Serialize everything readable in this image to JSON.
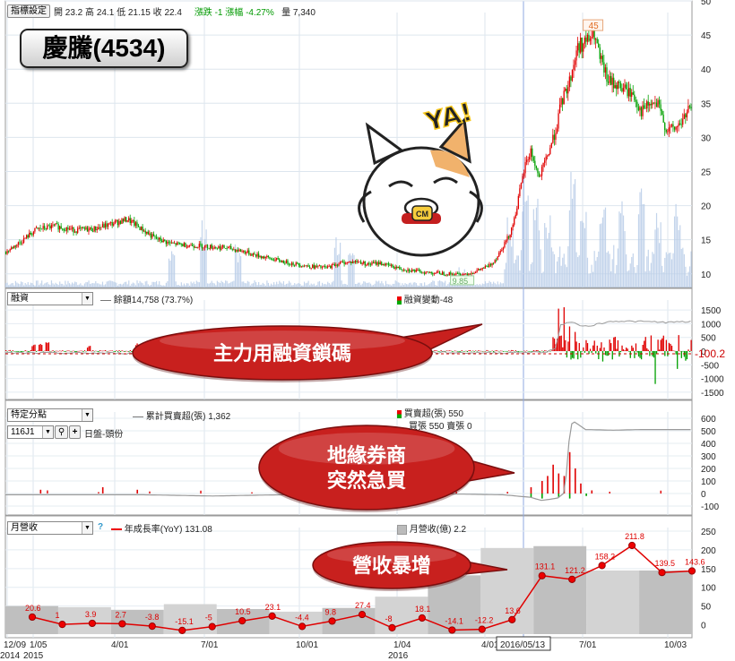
{
  "stock": {
    "name_code": "慶騰(4534)"
  },
  "price_panel": {
    "settings_button": "指標設定",
    "open_label": "開",
    "open": "23.2",
    "high_label": "高",
    "high": "24.1",
    "low_label": "低",
    "low": "21.15",
    "close_label": "收",
    "close": "22.4",
    "change_label": "漲跌",
    "change": "-1",
    "pct_label": "漲幅",
    "pct": "-4.27%",
    "vol_label": "量",
    "vol": "7,340",
    "peak_label": "45",
    "low_tag": "9.85",
    "sticker_text": "YA!",
    "sticker_badge": "CM"
  },
  "margin_panel": {
    "selector": "融資",
    "balance_text": "餘額14,758 (73.7%)",
    "change_text": "融資變動-48",
    "current_tag": "-100.2",
    "callout": "主力用融資鎖碼"
  },
  "broker_panel": {
    "selector": "特定分點",
    "broker_code": "116J1",
    "period_button": "日盤-頭份",
    "cum_text": "累計買賣超(張) 1,362",
    "net_text": "買賣超(張) 550",
    "buy_sell_text": "買張 550 賣張 0",
    "callout_line1": "地緣券商",
    "callout_line2": "突然急買"
  },
  "revenue_panel": {
    "selector": "月營收",
    "help": "?",
    "yoy_text": "年成長率(YoY) 131.08",
    "rev_text": "月營收(億) 2.2",
    "callout": "營收暴增"
  },
  "xaxis": {
    "labels": [
      "12/09",
      "1/05",
      "4/01",
      "7/01",
      "10/01",
      "1/04",
      "4/01",
      "7/01",
      "10/03"
    ],
    "years": [
      "2014",
      "2015",
      "2016"
    ],
    "cursor_date": "2016/05/13"
  },
  "colors": {
    "up": "#e00000",
    "down": "#00a000",
    "yoy_line": "#e00000",
    "callout": "#c8201e"
  },
  "chart_data": [
    {
      "type": "candlestick",
      "title": "慶騰(4534) daily price",
      "ylim": [
        8,
        50
      ],
      "yticks": [
        10,
        15,
        20,
        25,
        30,
        35,
        40,
        45,
        50
      ],
      "close_path": [
        [
          0,
          13.2
        ],
        [
          10,
          14.6
        ],
        [
          22,
          16.5
        ],
        [
          36,
          17
        ],
        [
          50,
          16.4
        ],
        [
          64,
          16.6
        ],
        [
          76,
          17.3
        ],
        [
          88,
          18
        ],
        [
          98,
          16.6
        ],
        [
          108,
          15.2
        ],
        [
          120,
          14.4
        ],
        [
          140,
          14.1
        ],
        [
          160,
          13.8
        ],
        [
          172,
          13.3
        ],
        [
          180,
          12.8
        ],
        [
          192,
          12.2
        ],
        [
          205,
          11.6
        ],
        [
          220,
          11.1
        ],
        [
          232,
          10.9
        ],
        [
          242,
          11.6
        ],
        [
          255,
          11.8
        ],
        [
          262,
          11.4
        ],
        [
          270,
          11.6
        ],
        [
          285,
          10.8
        ],
        [
          300,
          10.3
        ],
        [
          305,
          10.2
        ],
        [
          315,
          10.1
        ],
        [
          325,
          9.95
        ],
        [
          330,
          9.9
        ],
        [
          338,
          10.2
        ],
        [
          343,
          10.6
        ],
        [
          350,
          11.2
        ],
        [
          355,
          12.3
        ],
        [
          360,
          14.2
        ],
        [
          364,
          15.5
        ],
        [
          368,
          18
        ],
        [
          372,
          22
        ],
        [
          376,
          26
        ],
        [
          380,
          28
        ],
        [
          386,
          24
        ],
        [
          392,
          27.3
        ],
        [
          398,
          31
        ],
        [
          402,
          35
        ],
        [
          408,
          38.2
        ],
        [
          414,
          43.3
        ],
        [
          420,
          44
        ],
        [
          426,
          45
        ],
        [
          430,
          41.5
        ],
        [
          436,
          38.2
        ],
        [
          442,
          37.7
        ],
        [
          448,
          37
        ],
        [
          454,
          36.2
        ],
        [
          460,
          33.8
        ],
        [
          466,
          34.8
        ],
        [
          472,
          34.7
        ],
        [
          478,
          31.2
        ],
        [
          484,
          31.2
        ],
        [
          489,
          32.2
        ],
        [
          494,
          34
        ]
      ],
      "volume_spikes": [
        [
          120,
          6
        ],
        [
          143,
          9
        ],
        [
          168,
          5.5
        ],
        [
          240,
          7
        ],
        [
          250,
          5
        ],
        [
          330,
          3
        ],
        [
          365,
          6
        ],
        [
          376,
          11.5
        ],
        [
          384,
          10
        ],
        [
          392,
          7
        ],
        [
          410,
          11
        ],
        [
          418,
          9.5
        ],
        [
          432,
          8
        ],
        [
          446,
          9
        ],
        [
          460,
          10
        ],
        [
          472,
          6
        ],
        [
          486,
          7
        ]
      ],
      "peak": 45,
      "low": 9.85
    },
    {
      "type": "bar",
      "title": "融資變動",
      "ylim": [
        -1700,
        1700
      ],
      "yticks": [
        1500,
        1000,
        500,
        0,
        -500,
        -1000,
        -1500
      ],
      "spikes": [
        [
          20,
          220
        ],
        [
          25,
          260
        ],
        [
          30,
          300
        ],
        [
          60,
          180
        ],
        [
          95,
          280
        ],
        [
          120,
          320
        ],
        [
          400,
          1550
        ],
        [
          404,
          1600
        ],
        [
          408,
          900
        ],
        [
          412,
          700
        ],
        [
          420,
          400
        ],
        [
          426,
          380
        ],
        [
          440,
          500
        ],
        [
          456,
          280
        ],
        [
          480,
          300
        ],
        [
          410,
          -250
        ],
        [
          414,
          -300
        ],
        [
          432,
          -380
        ],
        [
          444,
          -200
        ],
        [
          460,
          -300
        ],
        [
          470,
          -1200
        ],
        [
          486,
          -650
        ],
        [
          492,
          -350
        ]
      ],
      "balance_path": [
        [
          0,
          -70
        ],
        [
          60,
          -70
        ],
        [
          100,
          -80
        ],
        [
          130,
          -60
        ],
        [
          160,
          -20
        ],
        [
          200,
          -10
        ],
        [
          260,
          -20
        ],
        [
          300,
          -40
        ],
        [
          330,
          -60
        ],
        [
          360,
          -60
        ],
        [
          390,
          -40
        ],
        [
          398,
          80
        ],
        [
          402,
          950
        ],
        [
          408,
          1060
        ],
        [
          420,
          900
        ],
        [
          440,
          1100
        ],
        [
          460,
          1080
        ],
        [
          480,
          1050
        ],
        [
          497,
          1080
        ]
      ]
    },
    {
      "type": "bar",
      "title": "買賣超(張)",
      "ylim": [
        -150,
        650
      ],
      "yticks": [
        600,
        500,
        400,
        300,
        200,
        100,
        0,
        -100
      ],
      "spikes": [
        [
          25,
          30
        ],
        [
          70,
          50
        ],
        [
          95,
          30
        ],
        [
          250,
          40
        ],
        [
          260,
          30
        ],
        [
          320,
          35
        ],
        [
          380,
          50
        ],
        [
          388,
          100
        ],
        [
          392,
          140
        ],
        [
          396,
          230
        ],
        [
          400,
          160
        ],
        [
          404,
          140
        ],
        [
          408,
          330
        ],
        [
          412,
          200
        ],
        [
          416,
          80
        ],
        [
          424,
          25
        ],
        [
          380,
          -30
        ],
        [
          388,
          -40
        ],
        [
          400,
          -30
        ],
        [
          408,
          -40
        ],
        [
          420,
          -20
        ]
      ],
      "cum_path": [
        [
          0,
          -10
        ],
        [
          100,
          -10
        ],
        [
          150,
          -20
        ],
        [
          200,
          -10
        ],
        [
          300,
          0
        ],
        [
          360,
          -10
        ],
        [
          380,
          -30
        ],
        [
          388,
          -55
        ],
        [
          395,
          -45
        ],
        [
          400,
          -35
        ],
        [
          405,
          10
        ],
        [
          409,
          550
        ],
        [
          412,
          570
        ],
        [
          420,
          510
        ],
        [
          440,
          505
        ],
        [
          460,
          510
        ],
        [
          497,
          510
        ]
      ]
    },
    {
      "type": "bar+line",
      "title": "月營收",
      "ylim": [
        -25,
        250
      ],
      "yticks": [
        250,
        200,
        150,
        100,
        50,
        0
      ],
      "revenue_blocks": [
        [
          0,
          50
        ],
        [
          60,
          47
        ],
        [
          150,
          40
        ],
        [
          220,
          55
        ],
        [
          280,
          42
        ],
        [
          360,
          35
        ],
        [
          420,
          45
        ],
        [
          500,
          75
        ],
        [
          560,
          132
        ],
        [
          640,
          205
        ],
        [
          700,
          210
        ],
        [
          760,
          145
        ],
        [
          790,
          145
        ]
      ],
      "yoy_points": [
        {
          "label": "20.6",
          "v": 20.6
        },
        {
          "label": "1",
          "v": 1
        },
        {
          "label": "3.9",
          "v": 3.9
        },
        {
          "label": "2.7",
          "v": 2.7
        },
        {
          "label": "-3.8",
          "v": -3.8
        },
        {
          "label": "-15.1",
          "v": -15.1
        },
        {
          "label": "-5",
          "v": -5
        },
        {
          "label": "10.5",
          "v": 10.5
        },
        {
          "label": "23.1",
          "v": 23.1
        },
        {
          "label": "-4.4",
          "v": -4.4
        },
        {
          "label": "9.8",
          "v": 9.8
        },
        {
          "label": "27.4",
          "v": 27.4
        },
        {
          "label": "-8",
          "v": -8
        },
        {
          "label": "18.1",
          "v": 18.1
        },
        {
          "label": "-14.1",
          "v": -14.1
        },
        {
          "label": "-12.2",
          "v": -12.2
        },
        {
          "label": "13.6",
          "v": 13.6
        },
        {
          "label": "131.1",
          "v": 131.1
        },
        {
          "label": "121.2",
          "v": 121.2
        },
        {
          "label": "158.2",
          "v": 158.2
        },
        {
          "label": "211.8",
          "v": 211.8
        },
        {
          "label": "139.5",
          "v": 139.5
        },
        {
          "label": "143.6",
          "v": 143.6
        }
      ]
    }
  ]
}
